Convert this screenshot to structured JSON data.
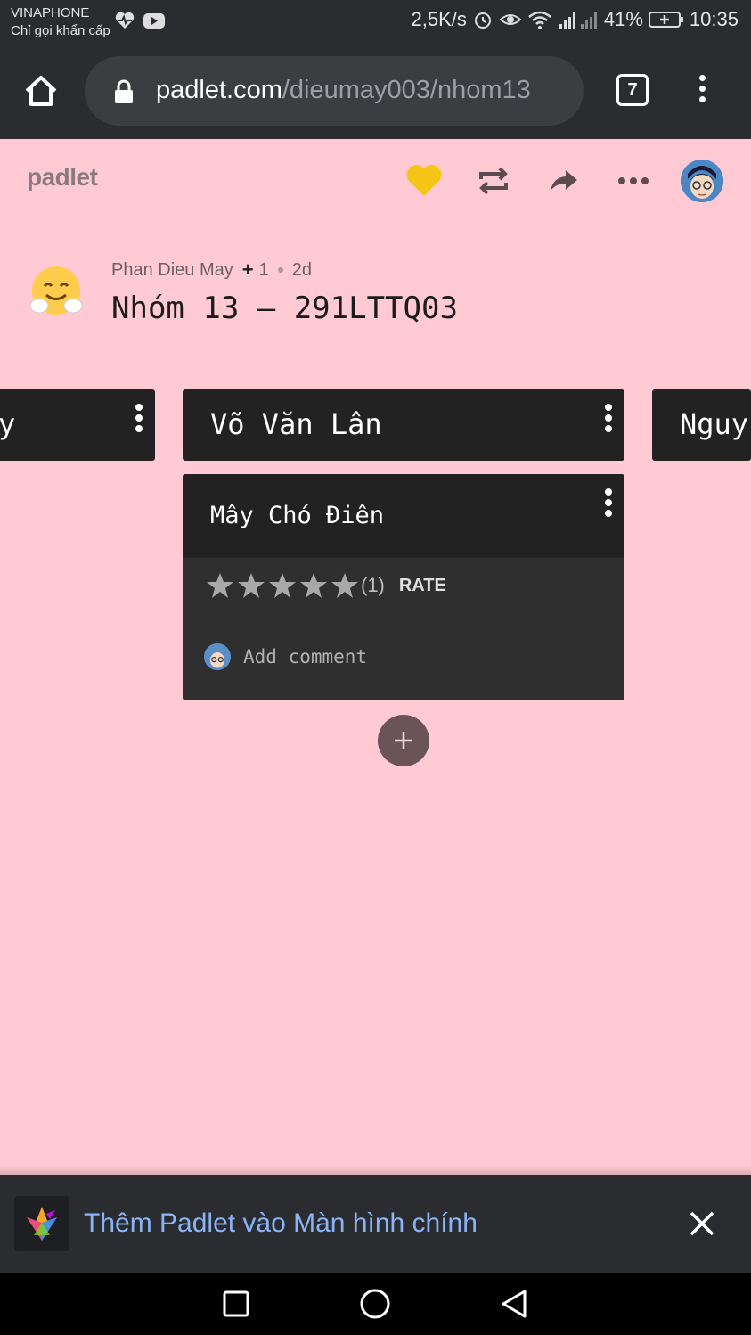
{
  "status_bar": {
    "carrier": "VINAPHONE",
    "carrier_sub": "Chỉ gọi khẩn cấp",
    "net_speed": "2,5K/s",
    "battery": "41%",
    "time": "10:35"
  },
  "browser": {
    "url_domain": "padlet.com",
    "url_path": "/dieumay003/nhom13",
    "tab_count": "7"
  },
  "padlet": {
    "logo": "padlet",
    "author": "Phan Dieu May",
    "plus": "+",
    "contributors": "1",
    "age": "2d",
    "title": "Nhóm 13 – 291LTTQ03",
    "accent_heart": "#f5c518",
    "background": "#ffcad4"
  },
  "columns": [
    {
      "label": "y"
    },
    {
      "label": "Võ Văn Lân"
    },
    {
      "label": "Nguy"
    }
  ],
  "card": {
    "title": "Mây Chó Điên",
    "rating_stars": 5,
    "rating_count": "(1)",
    "rate_label": "RATE",
    "comment_placeholder": "Add comment"
  },
  "banner": {
    "text": "Thêm Padlet vào Màn hình chính"
  },
  "icons": {
    "home": "home-icon",
    "lock": "lock-icon",
    "menu": "more-vert-icon",
    "heart": "heart-icon",
    "remake": "repeat-icon",
    "share": "share-icon",
    "more": "more-horiz-icon",
    "add": "plus-icon",
    "close": "close-icon"
  }
}
